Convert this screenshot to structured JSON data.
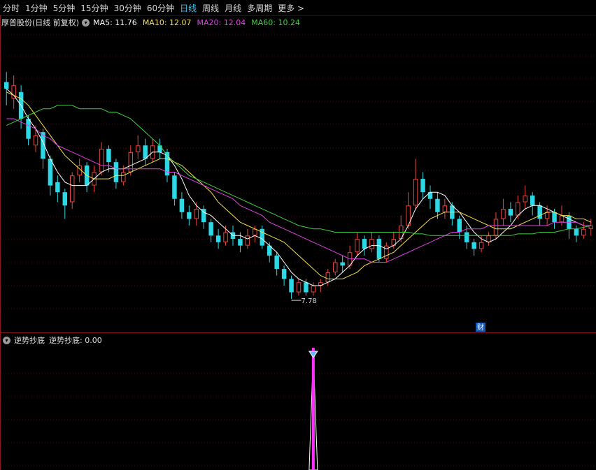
{
  "tabs": [
    "分时",
    "1分钟",
    "5分钟",
    "15分钟",
    "30分钟",
    "60分钟",
    "日线",
    "周线",
    "月线",
    "多周期",
    "更多 >"
  ],
  "active_tab": "日线",
  "stock": {
    "title": "厚普股份(日线 前复权)",
    "dropdown_icon": "chevron-down-icon"
  },
  "ma": [
    {
      "label": "MA5: 11.76",
      "color": "#ffffff"
    },
    {
      "label": "MA10: 12.07",
      "color": "#f5e14b"
    },
    {
      "label": "MA20: 12.04",
      "color": "#e040e0"
    },
    {
      "label": "MA60: 10.24",
      "color": "#40d040"
    }
  ],
  "low_marker": "7.78",
  "finance_badge": "财",
  "indicator": {
    "name": "逆势抄底",
    "value_label": "逆势抄底: 0.00",
    "signal_value": 1
  },
  "colors": {
    "up": "#e8473e",
    "down": "#2ad8e6",
    "grid": "#3a0f0f",
    "divider": "#8a1a1a"
  },
  "chart_data": {
    "type": "candlestick",
    "series": [
      {
        "name": "K",
        "candles": [
          [
            14.3,
            14.1,
            14.6,
            13.6
          ],
          [
            13.8,
            14.2,
            14.5,
            13.5
          ],
          [
            14.0,
            13.2,
            14.2,
            12.9
          ],
          [
            13.2,
            12.6,
            13.3,
            12.4
          ],
          [
            12.4,
            12.7,
            13.0,
            12.2
          ],
          [
            12.8,
            12.0,
            12.9,
            11.7
          ],
          [
            12.0,
            11.2,
            12.1,
            10.9
          ],
          [
            11.3,
            11.0,
            11.5,
            10.7
          ],
          [
            11.0,
            10.6,
            11.1,
            10.2
          ],
          [
            10.7,
            11.5,
            11.6,
            10.5
          ],
          [
            11.5,
            11.8,
            12.0,
            11.3
          ],
          [
            11.8,
            11.2,
            11.9,
            11.0
          ],
          [
            11.2,
            11.6,
            11.8,
            11.0
          ],
          [
            11.6,
            12.3,
            12.5,
            11.5
          ],
          [
            12.3,
            11.9,
            12.4,
            11.6
          ],
          [
            11.9,
            11.3,
            12.0,
            11.1
          ],
          [
            11.3,
            11.6,
            11.8,
            11.2
          ],
          [
            11.6,
            12.2,
            12.4,
            11.5
          ],
          [
            12.2,
            12.4,
            12.7,
            12.0
          ],
          [
            12.4,
            12.0,
            12.6,
            11.8
          ],
          [
            12.0,
            12.4,
            12.6,
            11.9
          ],
          [
            12.4,
            12.2,
            12.6,
            12.0
          ],
          [
            12.2,
            11.5,
            12.3,
            11.3
          ],
          [
            11.5,
            10.8,
            11.6,
            10.6
          ],
          [
            10.8,
            10.4,
            11.0,
            10.2
          ],
          [
            10.4,
            10.2,
            10.6,
            10.0
          ],
          [
            10.2,
            10.5,
            10.7,
            10.0
          ],
          [
            10.5,
            10.1,
            10.6,
            9.9
          ],
          [
            10.1,
            9.7,
            10.2,
            9.5
          ],
          [
            9.7,
            9.5,
            9.9,
            9.3
          ],
          [
            9.5,
            9.8,
            10.0,
            9.4
          ],
          [
            9.8,
            9.6,
            10.0,
            9.4
          ],
          [
            9.6,
            9.4,
            9.8,
            9.2
          ],
          [
            9.4,
            9.7,
            9.9,
            9.3
          ],
          [
            9.7,
            9.9,
            10.0,
            9.5
          ],
          [
            9.9,
            9.4,
            10.0,
            9.3
          ],
          [
            9.4,
            9.1,
            9.5,
            8.9
          ],
          [
            9.1,
            8.7,
            9.2,
            8.5
          ],
          [
            8.7,
            8.4,
            8.8,
            8.2
          ],
          [
            8.4,
            8.0,
            8.5,
            7.8
          ],
          [
            8.0,
            8.3,
            8.4,
            7.9
          ],
          [
            8.3,
            8.0,
            8.4,
            7.9
          ],
          [
            8.0,
            8.2,
            8.3,
            7.9
          ],
          [
            8.2,
            8.3,
            8.4,
            8.0
          ],
          [
            8.3,
            8.6,
            8.7,
            8.2
          ],
          [
            8.6,
            8.9,
            9.0,
            8.5
          ],
          [
            8.9,
            8.8,
            9.1,
            8.6
          ],
          [
            8.8,
            9.2,
            9.4,
            8.7
          ],
          [
            9.2,
            9.6,
            9.8,
            9.1
          ],
          [
            9.6,
            9.3,
            9.7,
            9.1
          ],
          [
            9.3,
            9.6,
            9.8,
            9.2
          ],
          [
            9.6,
            9.0,
            9.7,
            8.9
          ],
          [
            9.0,
            9.4,
            9.5,
            8.9
          ],
          [
            9.4,
            9.6,
            9.8,
            9.3
          ],
          [
            9.6,
            10.0,
            10.3,
            9.5
          ],
          [
            10.0,
            10.6,
            11.0,
            9.9
          ],
          [
            10.6,
            11.4,
            12.0,
            10.5
          ],
          [
            11.4,
            11.0,
            11.6,
            10.8
          ],
          [
            11.0,
            10.8,
            11.2,
            10.5
          ],
          [
            10.8,
            10.4,
            11.0,
            10.2
          ],
          [
            10.4,
            10.6,
            10.8,
            10.2
          ],
          [
            10.6,
            10.2,
            10.7,
            10.0
          ],
          [
            10.2,
            9.8,
            10.3,
            9.6
          ],
          [
            9.8,
            9.5,
            10.0,
            9.3
          ],
          [
            9.5,
            9.3,
            9.6,
            9.1
          ],
          [
            9.3,
            9.5,
            9.7,
            9.2
          ],
          [
            9.5,
            9.7,
            9.8,
            9.4
          ],
          [
            9.7,
            10.2,
            10.4,
            9.6
          ],
          [
            10.2,
            10.5,
            10.8,
            10.0
          ],
          [
            10.5,
            10.3,
            10.7,
            10.1
          ],
          [
            10.3,
            10.7,
            10.9,
            10.2
          ],
          [
            10.7,
            10.9,
            11.2,
            10.5
          ],
          [
            10.9,
            10.6,
            11.0,
            10.3
          ],
          [
            10.6,
            10.2,
            10.7,
            10.0
          ],
          [
            10.2,
            10.4,
            10.6,
            10.0
          ],
          [
            10.4,
            10.1,
            10.5,
            9.9
          ],
          [
            10.1,
            10.3,
            10.6,
            10.0
          ],
          [
            10.3,
            9.9,
            10.4,
            9.6
          ],
          [
            9.9,
            9.7,
            10.0,
            9.5
          ],
          [
            9.7,
            9.9,
            10.1,
            9.6
          ],
          [
            9.9,
            10.0,
            10.2,
            9.7
          ]
        ]
      },
      {
        "name": "MA5",
        "values": [
          14.1,
          13.9,
          13.6,
          13.2,
          12.9,
          12.5,
          12.0,
          11.6,
          11.3,
          11.2,
          11.2,
          11.2,
          11.4,
          11.6,
          11.7,
          11.7,
          11.7,
          11.8,
          11.9,
          12.0,
          12.2,
          12.2,
          12.1,
          11.8,
          11.4,
          10.9,
          10.6,
          10.4,
          10.3,
          10.1,
          9.9,
          9.7,
          9.7,
          9.6,
          9.7,
          9.6,
          9.4,
          9.2,
          8.9,
          8.6,
          8.4,
          8.3,
          8.2,
          8.2,
          8.3,
          8.4,
          8.6,
          8.8,
          9.1,
          9.3,
          9.4,
          9.4,
          9.3,
          9.4,
          9.6,
          10.0,
          10.5,
          10.8,
          11.0,
          11.0,
          10.9,
          10.6,
          10.4,
          10.1,
          9.8,
          9.6,
          9.5,
          9.6,
          9.8,
          10.0,
          10.3,
          10.5,
          10.6,
          10.6,
          10.5,
          10.4,
          10.3,
          10.2,
          10.1,
          10.0,
          10.0
        ]
      },
      {
        "name": "MA10",
        "values": [
          14.0,
          13.9,
          13.8,
          13.6,
          13.3,
          13.0,
          12.7,
          12.4,
          12.1,
          11.9,
          11.7,
          11.5,
          11.4,
          11.4,
          11.4,
          11.5,
          11.5,
          11.6,
          11.7,
          11.8,
          11.9,
          12.0,
          12.0,
          11.9,
          11.8,
          11.6,
          11.4,
          11.2,
          11.0,
          10.7,
          10.5,
          10.3,
          10.1,
          10.0,
          9.9,
          9.8,
          9.7,
          9.6,
          9.5,
          9.3,
          9.1,
          8.9,
          8.7,
          8.5,
          8.4,
          8.4,
          8.4,
          8.5,
          8.6,
          8.8,
          8.9,
          9.0,
          9.1,
          9.2,
          9.4,
          9.6,
          9.8,
          10.0,
          10.2,
          10.3,
          10.4,
          10.4,
          10.4,
          10.3,
          10.2,
          10.1,
          10.0,
          9.9,
          9.9,
          9.9,
          10.0,
          10.1,
          10.2,
          10.3,
          10.4,
          10.4,
          10.3,
          10.3,
          10.2,
          10.2,
          10.1
        ]
      },
      {
        "name": "MA20",
        "values": [
          13.2,
          13.2,
          13.1,
          13.0,
          12.9,
          12.7,
          12.6,
          12.4,
          12.3,
          12.2,
          12.1,
          12.0,
          11.9,
          11.8,
          11.8,
          11.7,
          11.7,
          11.7,
          11.7,
          11.7,
          11.7,
          11.7,
          11.6,
          11.6,
          11.5,
          11.4,
          11.3,
          11.2,
          11.1,
          11.0,
          10.9,
          10.8,
          10.6,
          10.5,
          10.4,
          10.3,
          10.1,
          10.0,
          9.9,
          9.8,
          9.7,
          9.6,
          9.5,
          9.4,
          9.3,
          9.2,
          9.1,
          9.0,
          9.0,
          9.0,
          8.9,
          8.9,
          8.9,
          9.0,
          9.1,
          9.2,
          9.3,
          9.4,
          9.5,
          9.6,
          9.7,
          9.8,
          9.8,
          9.9,
          9.9,
          9.9,
          10.0,
          10.0,
          10.0,
          10.0,
          10.0,
          10.0,
          10.0,
          10.0,
          10.0,
          10.1,
          10.1,
          10.1,
          10.1,
          10.0,
          10.0
        ]
      },
      {
        "name": "MA60",
        "values": [
          13.0,
          13.1,
          13.2,
          13.3,
          13.4,
          13.5,
          13.5,
          13.6,
          13.6,
          13.6,
          13.5,
          13.5,
          13.5,
          13.5,
          13.4,
          13.4,
          13.3,
          13.2,
          13.0,
          12.8,
          12.6,
          12.4,
          12.1,
          11.9,
          11.7,
          11.5,
          11.4,
          11.3,
          11.2,
          11.1,
          11.0,
          10.9,
          10.8,
          10.7,
          10.6,
          10.5,
          10.4,
          10.3,
          10.2,
          10.1,
          10.0,
          9.95,
          9.9,
          9.9,
          9.85,
          9.8,
          9.8,
          9.8,
          9.8,
          9.8,
          9.8,
          9.8,
          9.8,
          9.8,
          9.8,
          9.8,
          9.75,
          9.75,
          9.7,
          9.7,
          9.7,
          9.7,
          9.7,
          9.7,
          9.7,
          9.7,
          9.7,
          9.7,
          9.7,
          9.7,
          9.75,
          9.75,
          9.75,
          9.8,
          9.8,
          9.8,
          9.85,
          9.9,
          9.9,
          9.95,
          10.0
        ]
      }
    ],
    "signal_index": 42,
    "ylim": [
      7.3,
      15.0
    ],
    "grid": true
  }
}
